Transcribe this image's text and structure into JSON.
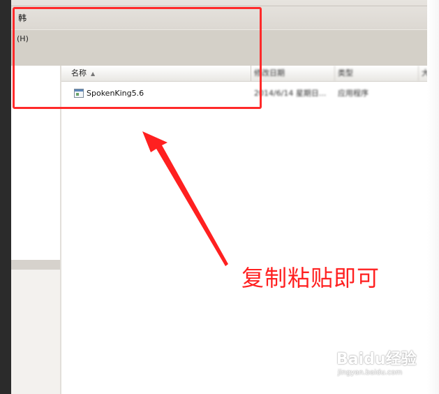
{
  "window": {
    "title": "韩",
    "menu": {
      "help_label": "(H)"
    }
  },
  "columns": {
    "name": "名称",
    "date": "修改日期",
    "type": "类型",
    "size": "大小"
  },
  "files": [
    {
      "name": "SpokenKing5.6",
      "date": "2014/6/14 星期日...",
      "type": "应用程序"
    }
  ],
  "annotation": {
    "text": "复制粘贴即可"
  },
  "colors": {
    "annotation": "#ff2020",
    "highlight_box": "#ff2a2a"
  },
  "icons": {
    "file": "application-icon",
    "sort": "sort-up-icon"
  },
  "watermark": {
    "logo": "Baidu经验",
    "url": "jingyan.baidu.com"
  }
}
